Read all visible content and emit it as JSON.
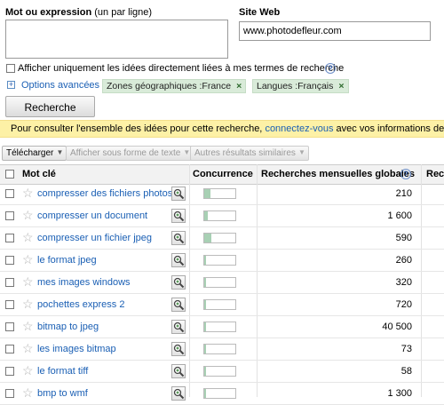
{
  "form": {
    "keyword_label": "Mot ou expression",
    "keyword_hint": "(un par ligne)",
    "site_label": "Site Web",
    "site_value": "www.photodefleur.com",
    "only_related_label": "Afficher uniquement les idées directement liées à mes termes de recherche",
    "help_icon": "?",
    "advanced_label": "Options avancées",
    "chips": [
      {
        "label": "Zones géographiques :France"
      },
      {
        "label": "Langues :Français"
      }
    ],
    "chip_close": "×",
    "search_button": "Recherche"
  },
  "banner": {
    "text_before": "Pour consulter l'ensemble des idées pour cette recherche,",
    "link": "connectez-vous",
    "text_after": "avec vos informations de co"
  },
  "toolbar": {
    "download": "Télécharger",
    "text_view": "Afficher sous forme de texte",
    "other_results": "Autres résultats similaires"
  },
  "table": {
    "headers": {
      "keyword": "Mot clé",
      "competition": "Concurrence",
      "global_searches": "Recherches mensuelles globales",
      "help": "?",
      "next": "Rech"
    },
    "rows": [
      {
        "keyword": "compresser des fichiers photos",
        "competition": 0.2,
        "searches": "210"
      },
      {
        "keyword": "compresser un document",
        "competition": 0.12,
        "searches": "1 600"
      },
      {
        "keyword": "compresser un fichier jpeg",
        "competition": 0.24,
        "searches": "590"
      },
      {
        "keyword": "le format jpeg",
        "competition": 0.05,
        "searches": "260"
      },
      {
        "keyword": "mes images windows",
        "competition": 0.05,
        "searches": "320"
      },
      {
        "keyword": "pochettes express 2",
        "competition": 0.05,
        "searches": "720"
      },
      {
        "keyword": "bitmap to jpeg",
        "competition": 0.05,
        "searches": "40 500"
      },
      {
        "keyword": "les images bitmap",
        "competition": 0.05,
        "searches": "73"
      },
      {
        "keyword": "le format tiff",
        "competition": 0.05,
        "searches": "58"
      },
      {
        "keyword": "bmp to wmf",
        "competition": 0.05,
        "searches": "1 300"
      }
    ]
  },
  "colors": {
    "banner_bg": "#fdf1a6",
    "chip_bg": "#d9ebd9",
    "link": "#1a5fb4",
    "competition_fill": "#a8d0b4"
  }
}
